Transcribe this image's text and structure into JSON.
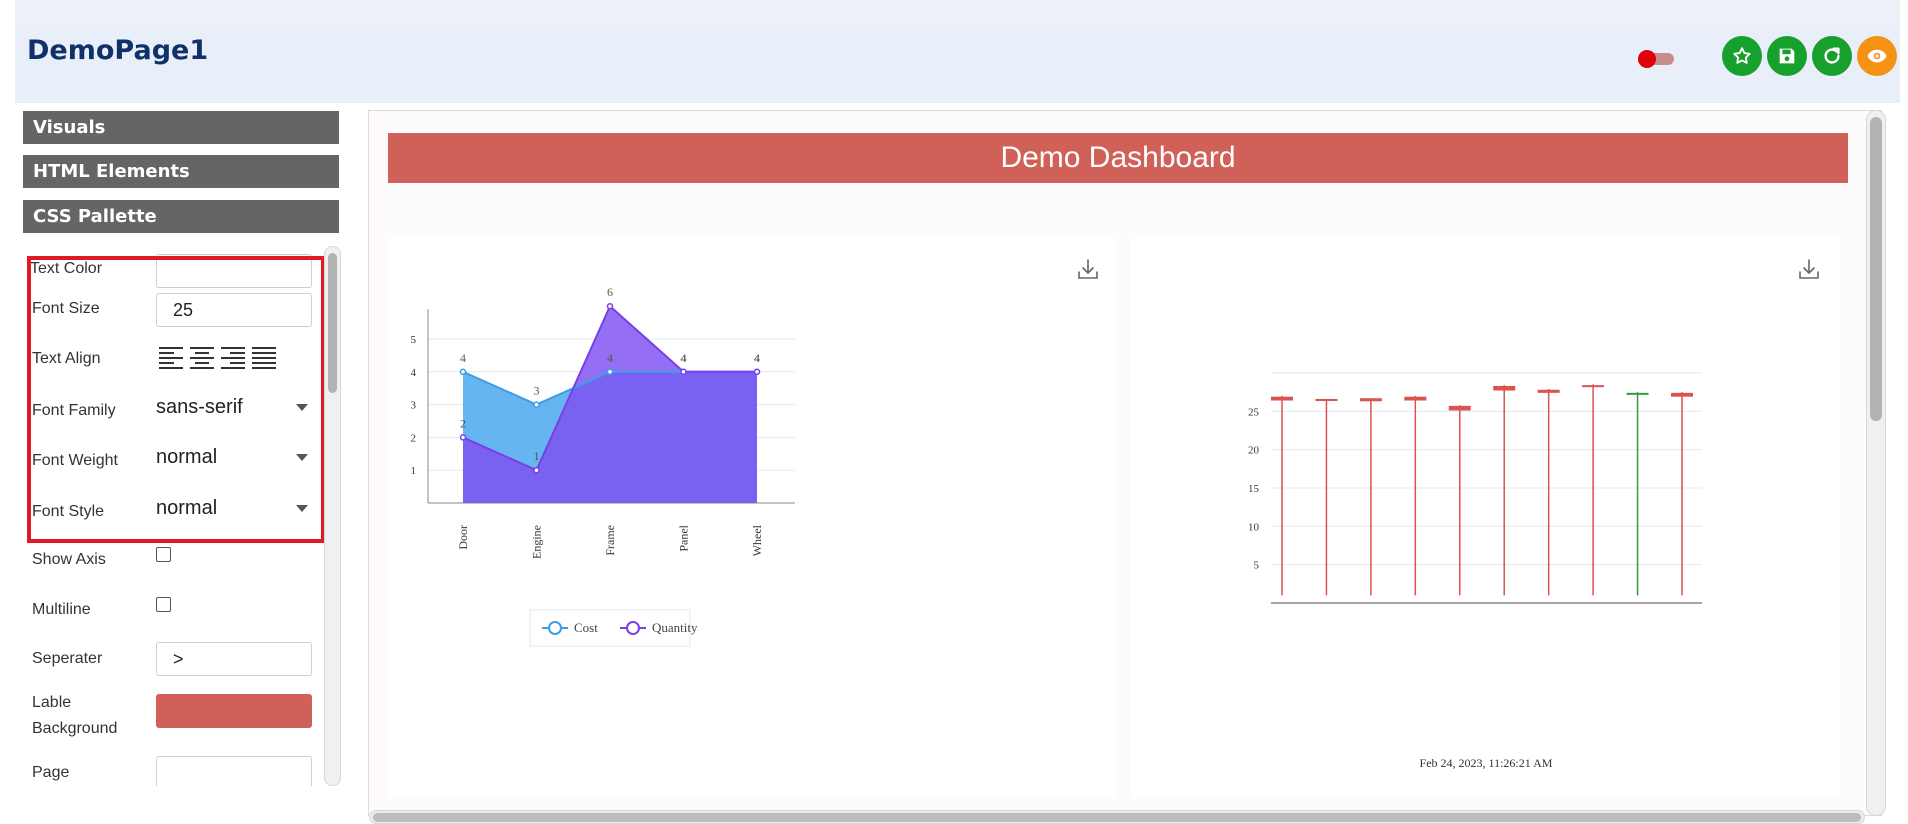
{
  "header": {
    "title": "DemoPage1",
    "toggle": {
      "on": true
    },
    "actions": [
      {
        "name": "favorite-button",
        "icon": "star-icon",
        "color": "#17a02c"
      },
      {
        "name": "save-button",
        "icon": "save-icon",
        "color": "#17a02c"
      },
      {
        "name": "refresh-button",
        "icon": "refresh-icon",
        "color": "#17a02c"
      },
      {
        "name": "preview-button",
        "icon": "eye-icon",
        "color": "#f39214"
      }
    ]
  },
  "sidebar": {
    "sections": [
      {
        "label": "Visuals"
      },
      {
        "label": "HTML Elements"
      },
      {
        "label": "CSS Pallette"
      }
    ],
    "properties": {
      "text_color": {
        "label": "Text Color",
        "value": ""
      },
      "font_size": {
        "label": "Font Size",
        "value": "25"
      },
      "text_align": {
        "label": "Text Align",
        "options": [
          "align-left-icon",
          "align-center-icon",
          "align-right-icon",
          "align-justify-icon"
        ]
      },
      "font_family": {
        "label": "Font Family",
        "value": "sans-serif"
      },
      "font_weight": {
        "label": "Font Weight",
        "value": "normal"
      },
      "font_style": {
        "label": "Font Style",
        "value": "normal"
      },
      "show_axis": {
        "label": "Show Axis",
        "checked": false
      },
      "multiline": {
        "label": "Multiline",
        "checked": false
      },
      "separator": {
        "label": "Seperater",
        "value": ">"
      },
      "label_background": {
        "label_line1": "Lable",
        "label_line2": "Background",
        "color": "#d06158"
      },
      "page": {
        "label": "Page",
        "value": ""
      }
    }
  },
  "dashboard": {
    "title": "Demo Dashboard",
    "title_background": "#d06158"
  },
  "chart_data": [
    {
      "type": "area",
      "categories": [
        "Door",
        "Engine",
        "Frame",
        "Panel",
        "Wheel"
      ],
      "series": [
        {
          "name": "Cost",
          "values": [
            4,
            3,
            4,
            4,
            4
          ],
          "color": "#4aa8ef"
        },
        {
          "name": "Quantity",
          "values": [
            2,
            1,
            6,
            4,
            4
          ],
          "color": "#7e4ff0"
        }
      ],
      "y_ticks": [
        1,
        2,
        3,
        4,
        5
      ],
      "ylim": [
        0,
        6
      ],
      "legend": "bottom",
      "grid": true
    },
    {
      "type": "candlestick",
      "x_label": "Feb 24, 2023, 11:26:21 AM",
      "y_ticks": [
        5,
        10,
        15,
        20,
        25
      ],
      "ylim": [
        0,
        30
      ],
      "grid": true,
      "candles": [
        {
          "low": 1,
          "high": 27,
          "open": 26.9,
          "close": 26.4,
          "color": "#d9534f"
        },
        {
          "low": 1,
          "high": 26.6,
          "open": 26.6,
          "close": 26.4,
          "color": "#d9534f"
        },
        {
          "low": 1,
          "high": 26.7,
          "open": 26.7,
          "close": 26.3,
          "color": "#d9534f"
        },
        {
          "low": 1,
          "high": 27,
          "open": 26.9,
          "close": 26.4,
          "color": "#d9534f"
        },
        {
          "low": 1,
          "high": 25.8,
          "open": 25.7,
          "close": 25.1,
          "color": "#d9534f"
        },
        {
          "low": 1,
          "high": 28.4,
          "open": 28.3,
          "close": 27.7,
          "color": "#d9534f"
        },
        {
          "low": 1,
          "high": 27.9,
          "open": 27.8,
          "close": 27.4,
          "color": "#d9534f"
        },
        {
          "low": 1,
          "high": 28.5,
          "open": 28.4,
          "close": 28.3,
          "color": "#d9534f"
        },
        {
          "low": 1,
          "high": 27.5,
          "open": 27.4,
          "close": 27.3,
          "color": "#2e9e3a"
        },
        {
          "low": 1,
          "high": 27.5,
          "open": 27.4,
          "close": 26.9,
          "color": "#d9534f"
        }
      ]
    }
  ]
}
